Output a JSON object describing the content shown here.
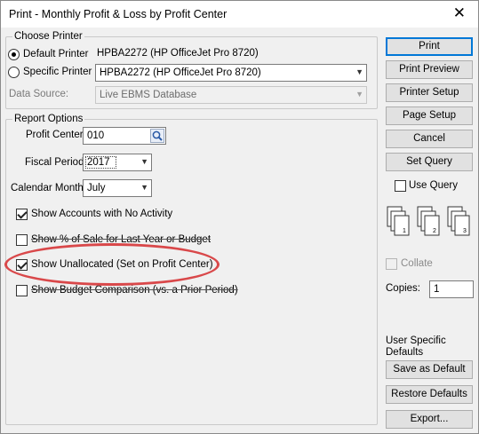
{
  "window": {
    "title": "Print - Monthly Profit & Loss by Profit Center",
    "close_glyph": "✕"
  },
  "choose_printer": {
    "legend": "Choose Printer",
    "default_printer_label": "Default Printer",
    "default_printer_value": "HPBA2272 (HP OfficeJet Pro 8720)",
    "specific_printer_label": "Specific Printer",
    "specific_printer_value": "HPBA2272 (HP OfficeJet Pro 8720)",
    "data_source_label": "Data Source:",
    "data_source_value": "Live EBMS Database",
    "selected": "default"
  },
  "report_options": {
    "legend": "Report Options",
    "profit_center_label": "Profit Center:",
    "profit_center_value": "010",
    "fiscal_period_label": "Fiscal Period:",
    "fiscal_period_value": "2017",
    "calendar_month_label": "Calendar Month:",
    "calendar_month_value": "July",
    "options": [
      {
        "label": "Show Accounts with No Activity",
        "checked": true
      },
      {
        "label": "Show % of Sale for Last Year or Budget",
        "checked": false
      },
      {
        "label": "Show Unallocated (Set on Profit Center)",
        "checked": true
      },
      {
        "label": "Show Budget Comparison (vs. a Prior Period)",
        "checked": false
      }
    ]
  },
  "buttons": {
    "print": "Print",
    "print_preview": "Print Preview",
    "printer_setup": "Printer Setup",
    "page_setup": "Page Setup",
    "cancel": "Cancel",
    "set_query": "Set Query",
    "save_as_default": "Save as Default",
    "restore_defaults": "Restore Defaults",
    "export": "Export..."
  },
  "side": {
    "use_query_label": "Use Query",
    "use_query_checked": false,
    "collate_label": "Collate",
    "collate_enabled": false,
    "copies_label": "Copies:",
    "copies_value": "1",
    "user_defaults_line1": "User Specific",
    "user_defaults_line2": "Defaults",
    "collate_page_numbers": [
      "1",
      "2",
      "3"
    ]
  },
  "colors": {
    "highlight": "#d9484a",
    "primary_border": "#0078d7"
  }
}
